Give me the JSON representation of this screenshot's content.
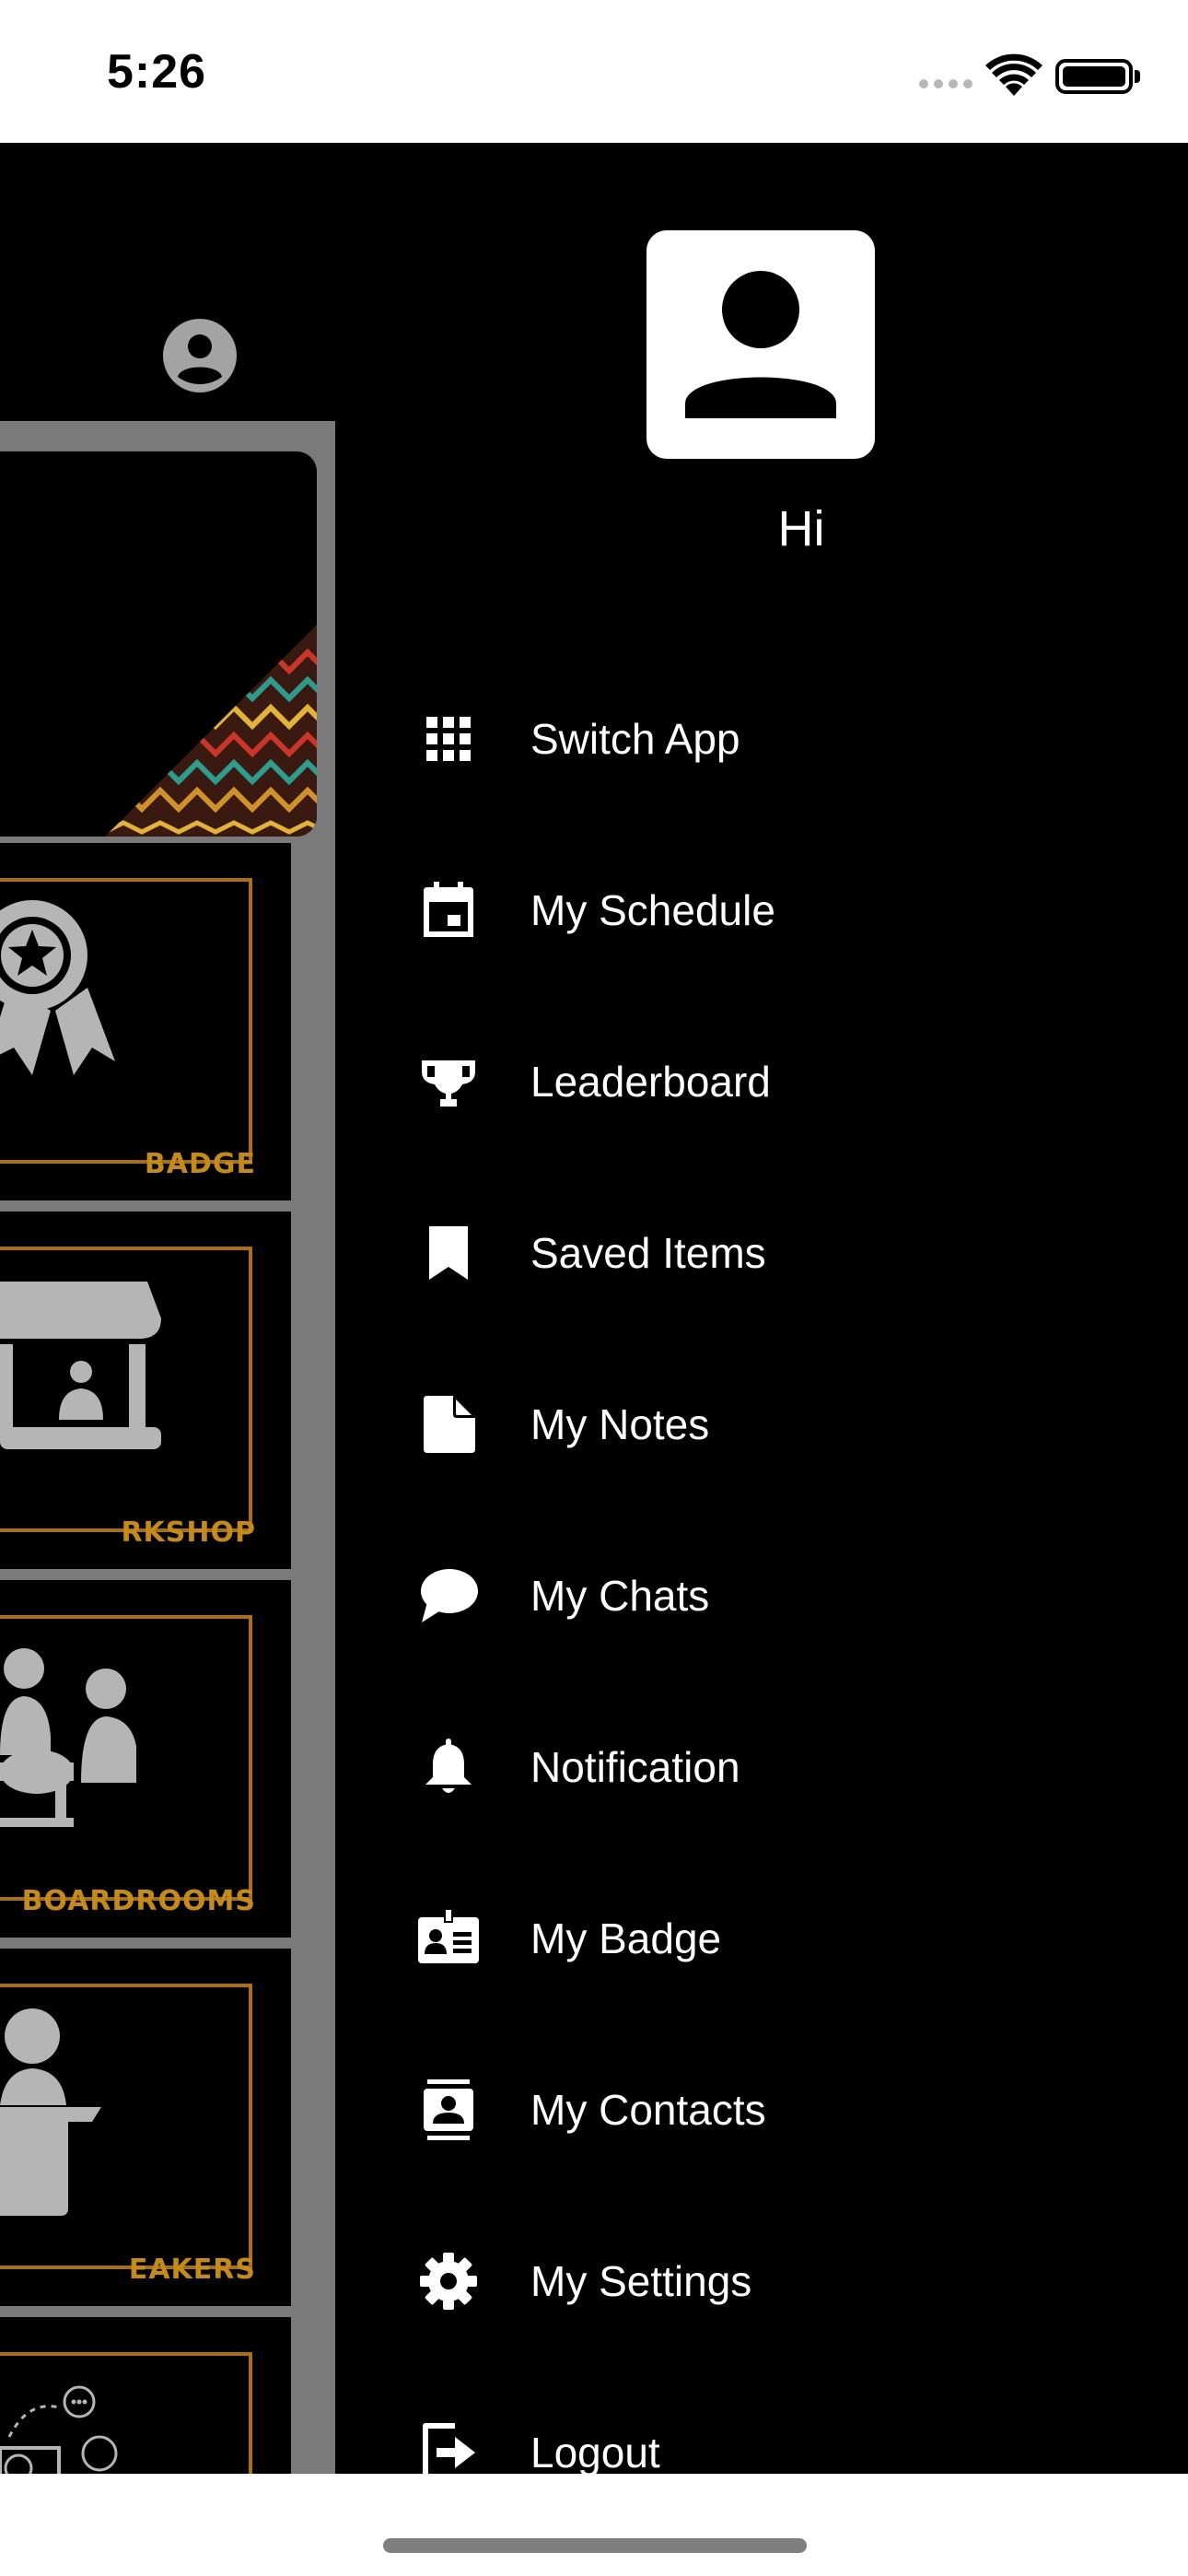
{
  "status_bar": {
    "time": "5:26"
  },
  "background_app": {
    "tiles": [
      {
        "label": "BADGE",
        "icon": "award-badge-icon"
      },
      {
        "label": "RKSHOP",
        "icon": "workshop-booth-icon"
      },
      {
        "label": "BOARDROOMS",
        "icon": "meeting-group-icon"
      },
      {
        "label": "EAKERS",
        "icon": "speaker-podium-icon"
      },
      {
        "label": "",
        "icon": "social-media-icon"
      }
    ],
    "accent_color": "#c58a1c"
  },
  "drawer": {
    "greeting": "Hi",
    "menu": [
      {
        "label": "Switch App",
        "icon": "grid-icon"
      },
      {
        "label": "My Schedule",
        "icon": "calendar-icon"
      },
      {
        "label": "Leaderboard",
        "icon": "trophy-icon"
      },
      {
        "label": "Saved Items",
        "icon": "bookmark-icon"
      },
      {
        "label": "My Notes",
        "icon": "note-icon"
      },
      {
        "label": "My Chats",
        "icon": "chat-icon"
      },
      {
        "label": "Notification",
        "icon": "bell-icon"
      },
      {
        "label": "My Badge",
        "icon": "id-badge-icon"
      },
      {
        "label": "My Contacts",
        "icon": "contacts-icon"
      },
      {
        "label": "My Settings",
        "icon": "gear-icon"
      },
      {
        "label": "Logout",
        "icon": "logout-icon"
      }
    ]
  }
}
